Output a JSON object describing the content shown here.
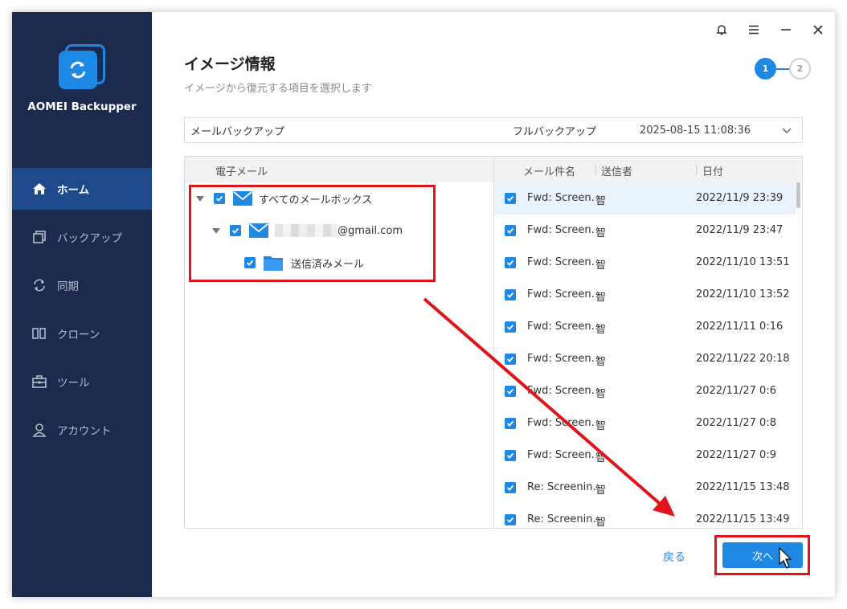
{
  "app": {
    "name": "AOMEI Backupper"
  },
  "sidebar": {
    "items": [
      {
        "label": "ホーム",
        "icon": "home-icon",
        "active": true
      },
      {
        "label": "バックアップ",
        "icon": "backup-icon",
        "active": false
      },
      {
        "label": "同期",
        "icon": "sync-icon",
        "active": false
      },
      {
        "label": "クローン",
        "icon": "clone-icon",
        "active": false
      },
      {
        "label": "ツール",
        "icon": "tools-icon",
        "active": false
      },
      {
        "label": "アカウント",
        "icon": "account-icon",
        "active": false
      }
    ]
  },
  "titlebar": {
    "icons": [
      "bell-icon",
      "menu-icon",
      "minimize-icon",
      "close-icon"
    ]
  },
  "page": {
    "title": "イメージ情報",
    "subtitle": "イメージから復元する項目を選択します",
    "steps": [
      "1",
      "2"
    ],
    "current_step": 1
  },
  "backup_select": {
    "name": "メールバックアップ",
    "type": "フルバックアップ",
    "time": "2025-08-15 11:08:36"
  },
  "tree": {
    "header": "電子メール",
    "nodes": [
      {
        "label": "すべてのメールボックス",
        "checked": true
      },
      {
        "label": "@gmail.com",
        "checked": true
      },
      {
        "label": "送信済みメール",
        "checked": true
      }
    ]
  },
  "mail_list": {
    "columns": [
      "メール件名",
      "送信者",
      "日付"
    ],
    "rows": [
      {
        "subject": "Fwd: Screen...",
        "sender": "智",
        "date": "2022/11/9 23:39",
        "checked": true
      },
      {
        "subject": "Fwd: Screen...",
        "sender": "智",
        "date": "2022/11/9 23:47",
        "checked": true
      },
      {
        "subject": "Fwd: Screen...",
        "sender": "智",
        "date": "2022/11/10 13:51",
        "checked": true
      },
      {
        "subject": "Fwd: Screen...",
        "sender": "智",
        "date": "2022/11/10 13:52",
        "checked": true
      },
      {
        "subject": "Fwd: Screen...",
        "sender": "智",
        "date": "2022/11/11 0:16",
        "checked": true
      },
      {
        "subject": "Fwd: Screen...",
        "sender": "智",
        "date": "2022/11/22 20:18",
        "checked": true
      },
      {
        "subject": "Fwd: Screen...",
        "sender": "智",
        "date": "2022/11/27 0:6",
        "checked": true
      },
      {
        "subject": "Fwd: Screen...",
        "sender": "智",
        "date": "2022/11/27 0:8",
        "checked": true
      },
      {
        "subject": "Fwd: Screen...",
        "sender": "智",
        "date": "2022/11/27 0:9",
        "checked": true
      },
      {
        "subject": "Re: Screenin...",
        "sender": "智",
        "date": "2022/11/15 13:48",
        "checked": true
      },
      {
        "subject": "Re: Screenin...",
        "sender": "智",
        "date": "2022/11/15 13:49",
        "checked": true
      }
    ]
  },
  "footer": {
    "back_label": "戻る",
    "next_label": "次へ"
  },
  "colors": {
    "sidebar": "#1b2a4d",
    "accent": "#1e88e5",
    "highlight": "#e0151c"
  }
}
